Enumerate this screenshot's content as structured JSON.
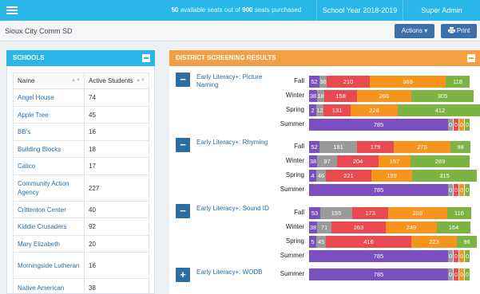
{
  "topbar": {
    "seats_available": "50",
    "seats_mid": "available seats out of",
    "seats_total": "900",
    "seats_tail": "seats purchased",
    "year": "School Year 2018-2019",
    "user": "Super Admin"
  },
  "subbar": {
    "district": "Sioux City Comm SD",
    "actions": "Actions ▾",
    "print": "Print"
  },
  "schools": {
    "title": "SCHOOLS",
    "col_name": "Name",
    "col_students": "Active Students",
    "rows": [
      {
        "name": "Angel House",
        "students": "74"
      },
      {
        "name": "Apple Tree",
        "students": "45"
      },
      {
        "name": "BB's",
        "students": "16"
      },
      {
        "name": "Building Blocks",
        "students": "18"
      },
      {
        "name": "Calico",
        "students": "17"
      },
      {
        "name": "Community Action Agency",
        "students": "227"
      },
      {
        "name": "Crittenton Center",
        "students": "40"
      },
      {
        "name": "Kiddie Crusaders",
        "students": "92"
      },
      {
        "name": "Mary Elizabeth",
        "students": "20"
      },
      {
        "name": "Morningside Lutheran",
        "students": "16"
      },
      {
        "name": "Native American",
        "students": "38"
      }
    ]
  },
  "results": {
    "title": "DISTRICT SCREENING RESULTS",
    "colors": {
      "purple": "#7a4fbf",
      "gray": "#9a9a9a",
      "red": "#e84a4f",
      "orange": "#f7941d",
      "green": "#7cb342"
    },
    "tests": [
      {
        "name": "Early Literacy+: Picture Naming",
        "expanded": true,
        "rows": [
          {
            "season": "Fall",
            "values": [
              "52",
              "36",
              "210",
              "369",
              "118"
            ]
          },
          {
            "season": "Winter",
            "values": [
              "38",
              "18",
              "158",
              "266",
              "305"
            ]
          },
          {
            "season": "Spring",
            "values": [
              "2",
              "12",
              "131",
              "228",
              "412"
            ]
          },
          {
            "season": "Summer",
            "values": [
              "785",
              "0",
              "0",
              "0",
              "0"
            ]
          }
        ]
      },
      {
        "name": "Early Literacy+: Rhyming",
        "expanded": true,
        "rows": [
          {
            "season": "Fall",
            "values": [
              "52",
              "181",
              "179",
              "275",
              "98"
            ]
          },
          {
            "season": "Winter",
            "values": [
              "38",
              "97",
              "204",
              "157",
              "289"
            ]
          },
          {
            "season": "Spring",
            "values": [
              "4",
              "46",
              "221",
              "199",
              "315"
            ]
          },
          {
            "season": "Summer",
            "values": [
              "785",
              "0",
              "0",
              "0",
              "0"
            ]
          }
        ]
      },
      {
        "name": "Early Literacy+: Sound ID",
        "expanded": true,
        "rows": [
          {
            "season": "Fall",
            "values": [
              "53",
              "155",
              "173",
              "288",
              "116"
            ]
          },
          {
            "season": "Winter",
            "values": [
              "38",
              "71",
              "263",
              "249",
              "164"
            ]
          },
          {
            "season": "Spring",
            "values": [
              "5",
              "45",
              "416",
              "223",
              "96"
            ]
          },
          {
            "season": "Summer",
            "values": [
              "785",
              "0",
              "0",
              "0",
              "0"
            ]
          }
        ]
      },
      {
        "name": "Early Literacy+: WODB",
        "expanded": false,
        "rows": [
          {
            "season": "Summer",
            "values": [
              "785",
              "0",
              "0",
              "0",
              "0"
            ]
          }
        ]
      }
    ]
  }
}
